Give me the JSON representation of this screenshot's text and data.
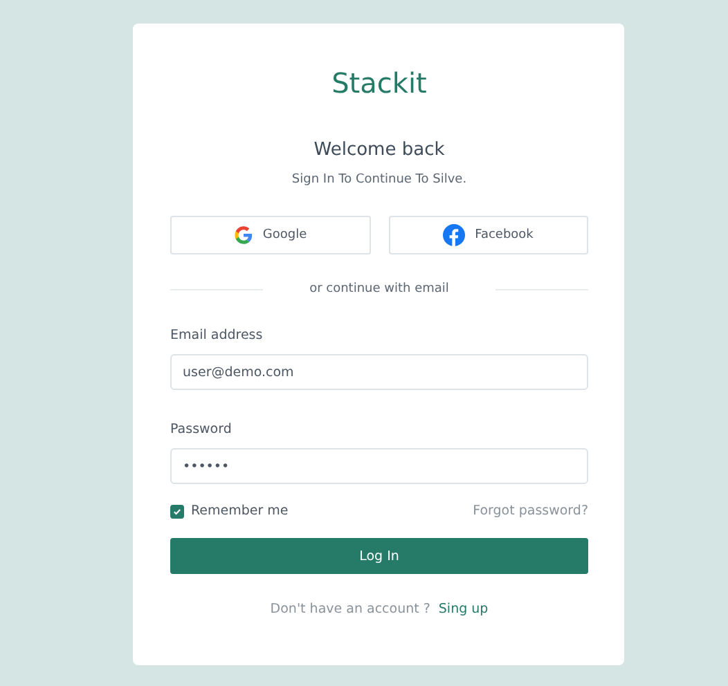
{
  "brand": "Stackit",
  "heading": "Welcome back",
  "subtitle": "Sign In To Continue To Silve.",
  "social_buttons": [
    {
      "kind": "google",
      "label": "Google"
    },
    {
      "kind": "facebook",
      "label": "Facebook"
    }
  ],
  "divider_text": "or continue with email",
  "fields": [
    {
      "label": "Email address",
      "value": "user@demo.com"
    },
    {
      "label": "Password",
      "value": "••••••"
    }
  ],
  "remember": {
    "label": "Remember me",
    "checked": true
  },
  "forgot_link": "Forgot password?",
  "submit": "Log In",
  "footer": {
    "text": "Don't have an account ?",
    "link": "Sing up"
  }
}
